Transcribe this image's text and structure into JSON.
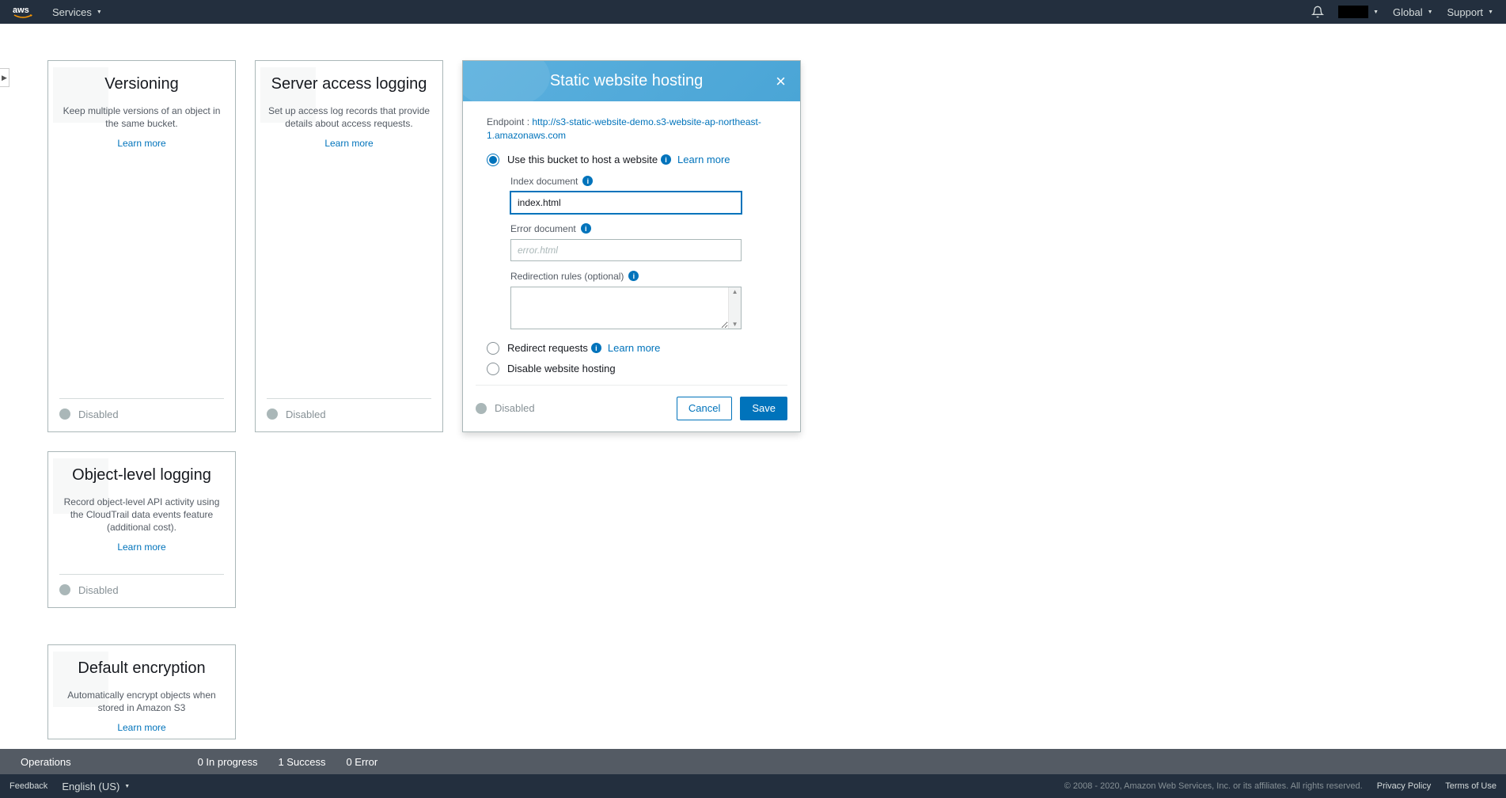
{
  "topnav": {
    "services": "Services",
    "global": "Global",
    "support": "Support"
  },
  "cards": {
    "versioning": {
      "title": "Versioning",
      "desc": "Keep multiple versions of an object in the same bucket.",
      "learn": "Learn more",
      "status": "Disabled"
    },
    "accessLogging": {
      "title": "Server access logging",
      "desc": "Set up access log records that provide details about access requests.",
      "learn": "Learn more",
      "status": "Disabled"
    },
    "objectLogging": {
      "title": "Object-level logging",
      "desc": "Record object-level API activity using the CloudTrail data events feature (additional cost).",
      "learn": "Learn more",
      "status": "Disabled"
    },
    "encryption": {
      "title": "Default encryption",
      "desc": "Automatically encrypt objects when stored in Amazon S3",
      "learn": "Learn more"
    }
  },
  "hosting": {
    "title": "Static website hosting",
    "endpointLabel": "Endpoint : ",
    "endpointUrl": "http://s3-static-website-demo.s3-website-ap-northeast-1.amazonaws.com",
    "optHost": "Use this bucket to host a website",
    "optHostLearn": "Learn more",
    "indexLabel": "Index document",
    "indexValue": "index.html",
    "errorLabel": "Error document",
    "errorPlaceholder": "error.html",
    "redirectLabel": "Redirection rules (optional)",
    "optRedirect": "Redirect requests",
    "optRedirectLearn": "Learn more",
    "optDisable": "Disable website hosting",
    "status": "Disabled",
    "cancel": "Cancel",
    "save": "Save"
  },
  "ops": {
    "label": "Operations",
    "inprogress": "0 In progress",
    "success": "1 Success",
    "error": "0 Error"
  },
  "footer": {
    "feedback": "Feedback",
    "lang": "English (US)",
    "copy": "© 2008 - 2020, Amazon Web Services, Inc. or its affiliates. All rights reserved.",
    "privacy": "Privacy Policy",
    "terms": "Terms of Use"
  }
}
